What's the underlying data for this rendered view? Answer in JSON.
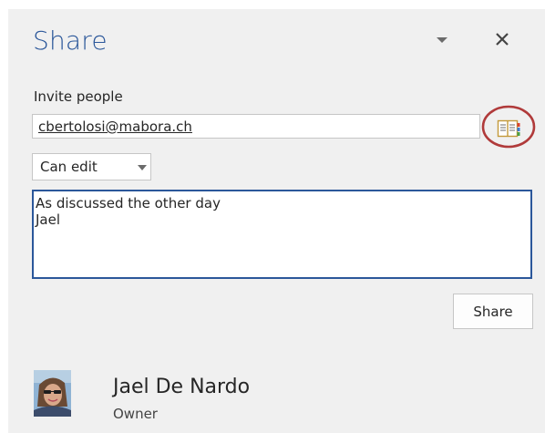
{
  "pane": {
    "title": "Share",
    "menu_icon": "chevron-down-icon",
    "close_icon": "close-icon"
  },
  "invite": {
    "label": "Invite people",
    "recipient": "cbertolosi@mabora.ch",
    "address_book_icon": "address-book-icon",
    "address_book_highlight_color": "#b03a3a",
    "permission": "Can edit",
    "message": "As discussed the other day\nJael",
    "share_label": "Share"
  },
  "people": [
    {
      "name": "Jael De Nardo",
      "role": "Owner"
    }
  ],
  "colors": {
    "accent": "#2b579a",
    "pane_background": "#f0f0f0"
  }
}
